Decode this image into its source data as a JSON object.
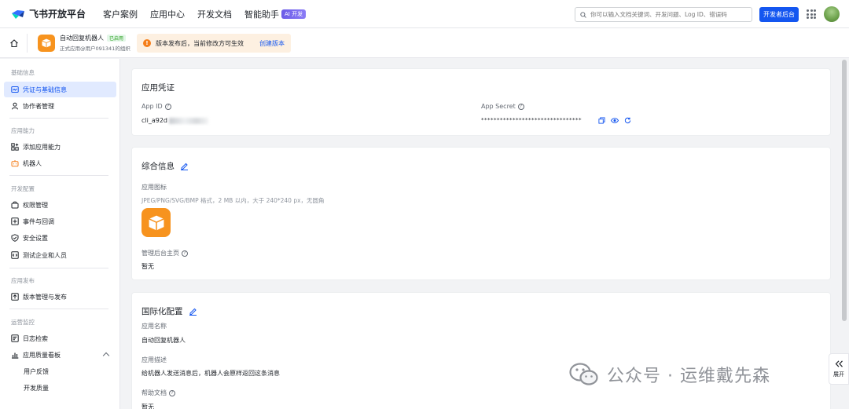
{
  "topnav": {
    "logo_text": "飞书开放平台",
    "links": [
      "客户案例",
      "应用中心",
      "开发文档",
      "智能助手"
    ],
    "ai_badge": "AI 开发",
    "search_placeholder": "你可以输入文档关键词、开发问题、Log ID、错误码",
    "dev_console": "开发者后台"
  },
  "appbar": {
    "app_name": "自动回复机器人",
    "status_badge": "已启用",
    "app_sub": "正式应用@用户091341的组织",
    "notice_text": "版本发布后，当前修改方可生效",
    "notice_link": "创建版本"
  },
  "sidebar": {
    "groups": [
      {
        "title": "基础信息",
        "items": [
          "凭证与基础信息",
          "协作者管理"
        ]
      },
      {
        "title": "应用能力",
        "items": [
          "添加应用能力",
          "机器人"
        ]
      },
      {
        "title": "开发配置",
        "items": [
          "权限管理",
          "事件与回调",
          "安全设置",
          "测试企业和人员"
        ]
      },
      {
        "title": "应用发布",
        "items": [
          "版本管理与发布"
        ]
      },
      {
        "title": "运营监控",
        "items": [
          "日志检索",
          "应用质量看板",
          "用户反馈",
          "开发质量"
        ]
      }
    ],
    "active": "凭证与基础信息"
  },
  "credentials": {
    "title": "应用凭证",
    "app_id_label": "App ID",
    "app_id_value": "cli_a92d",
    "secret_label": "App Secret",
    "secret_value": "********************************"
  },
  "general": {
    "title": "综合信息",
    "icon_label": "应用图标",
    "icon_hint": "JPEG/PNG/SVG/BMP 格式，2 MB 以内，大于 240*240 px，无圆角",
    "admin_label": "管理后台主页",
    "admin_value": "暂无"
  },
  "i18n": {
    "title": "国际化配置",
    "name_label": "应用名称",
    "name_value": "自动回复机器人",
    "desc_label": "应用描述",
    "desc_value": "给机器人发送消息后，机器人会原样返回这条消息",
    "help_label": "帮助文档",
    "help_value": "暂无"
  },
  "expand_label": "展开",
  "watermark": "公众号 · 运维戴先森",
  "colors": {
    "accent": "#1456f0",
    "app_icon": "#f7931e",
    "notice_bg": "#fdf0e1",
    "success": "#2ea121"
  }
}
